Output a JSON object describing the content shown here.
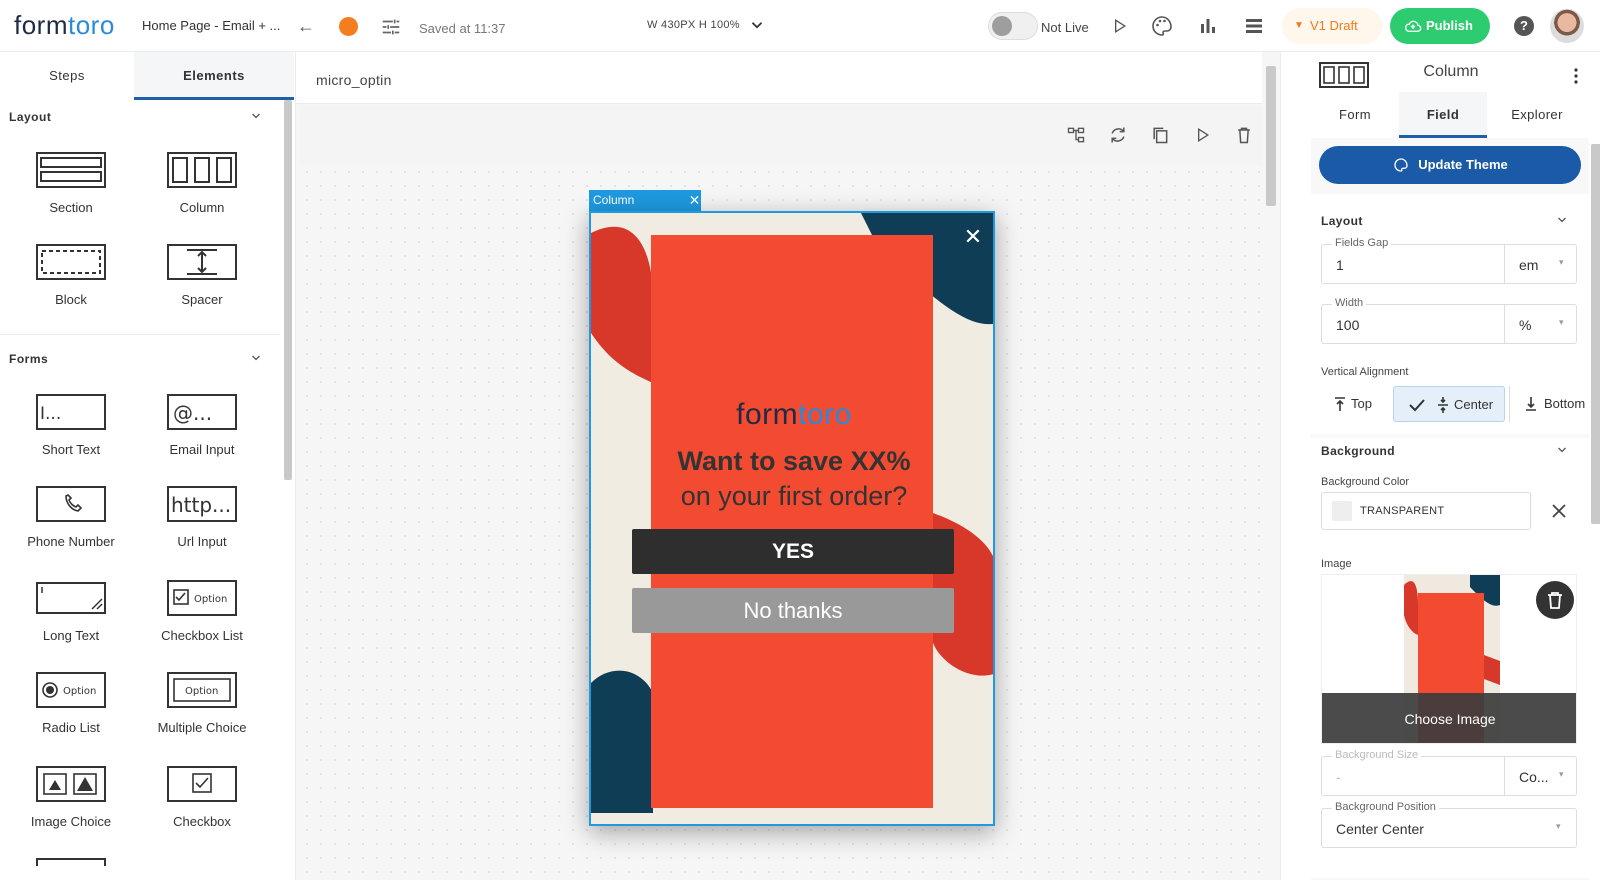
{
  "header": {
    "logo_main": "formtoro",
    "breadcrumb": "Home Page - Email + ...",
    "saved": "Saved at 11:37",
    "dimensions": "W 430PX  H 100%",
    "status": "Not Live",
    "draft_label": "V1 Draft",
    "publish_label": "Publish",
    "help": "?",
    "accent_color": "#f57c1f",
    "publish_color": "#2ecc71"
  },
  "left": {
    "tabs": [
      "Steps",
      "Elements"
    ],
    "layout_heading": "Layout",
    "forms_heading": "Forms",
    "layout_items": [
      "Section",
      "Column",
      "Block",
      "Spacer"
    ],
    "form_items": [
      "Short Text",
      "Email Input",
      "Phone Number",
      "Url Input",
      "Long Text",
      "Checkbox List",
      "Radio List",
      "Multiple Choice",
      "Image Choice",
      "Checkbox"
    ],
    "icon_text": {
      "short": "I...",
      "email": "@...",
      "url": "http...",
      "option": "Option"
    }
  },
  "canvas": {
    "name": "micro_optin",
    "column_tag": "Column",
    "popup": {
      "logo": "formtoro",
      "headline_bold": "Want to save XX%",
      "headline_light": "on your first order?",
      "yes": "YES",
      "no": "No thanks",
      "panel_color": "#f34a32"
    }
  },
  "right": {
    "title": "Column",
    "tabs": [
      "Form",
      "Field",
      "Explorer"
    ],
    "update_theme": "Update Theme",
    "layout_heading": "Layout",
    "fields_gap": {
      "label": "Fields Gap",
      "value": "1",
      "unit": "em"
    },
    "width": {
      "label": "Width",
      "value": "100",
      "unit": "%"
    },
    "valign": {
      "label": "Vertical Alignment",
      "options": [
        "Top",
        "Center",
        "Bottom"
      ],
      "selected": "Center"
    },
    "background_heading": "Background",
    "bg_color": {
      "label": "Background Color",
      "value": "TRANSPARENT"
    },
    "image_label": "Image",
    "choose_image": "Choose Image",
    "bg_size": {
      "label": "Background Size",
      "value": "-",
      "unit": "Co..."
    },
    "bg_position": {
      "label": "Background Position",
      "value": "Center Center"
    }
  }
}
